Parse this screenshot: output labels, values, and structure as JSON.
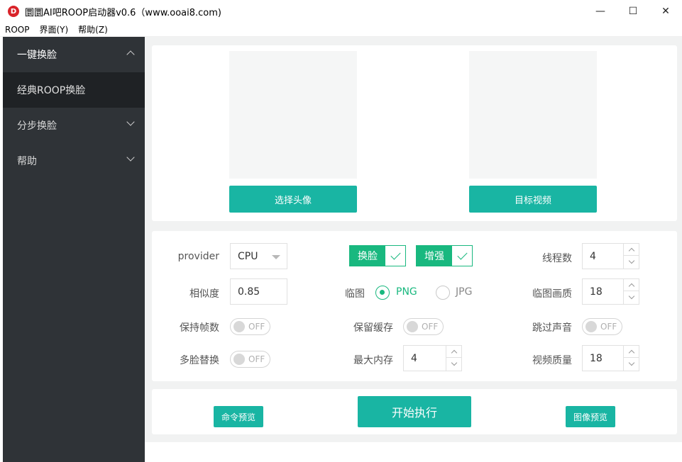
{
  "window": {
    "icon_letter": "D",
    "title": "圜圜AI吧ROOP启动器v0.6（www.ooai8.com)",
    "minimize": "—",
    "maximize": "☐",
    "close": "✕"
  },
  "menubar": [
    "ROOP",
    "界面(Y)",
    "帮助(Z)"
  ],
  "sidebar": {
    "groups": [
      {
        "label": "一键换脸",
        "expanded": true
      },
      {
        "label": "分步换脸",
        "expanded": false
      },
      {
        "label": "帮助",
        "expanded": false
      }
    ],
    "active_sub": "经典ROOP换脸"
  },
  "media": {
    "select_avatar": "选择头像",
    "target_video": "目标视频"
  },
  "settings": {
    "provider_label": "provider",
    "provider_value": "CPU",
    "similarity_label": "相似度",
    "similarity_value": "0.85",
    "keep_fps_label": "保持帧数",
    "multi_face_label": "多脸替换",
    "swap_face_tag": "换脸",
    "enhance_tag": "增强",
    "temp_frame_label": "临图",
    "format_png": "PNG",
    "format_jpg": "JPG",
    "format_selected": "PNG",
    "keep_cache_label": "保留缓存",
    "max_memory_label": "最大内存",
    "max_memory_value": "4",
    "threads_label": "线程数",
    "threads_value": "4",
    "temp_quality_label": "临图画质",
    "temp_quality_value": "18",
    "skip_audio_label": "跳过声音",
    "video_quality_label": "视频质量",
    "video_quality_value": "18",
    "off_text": "OFF"
  },
  "actions": {
    "command_preview": "命令预览",
    "start": "开始执行",
    "image_preview": "图像预览"
  },
  "colors": {
    "teal": "#19b5a3",
    "green": "#19b87f",
    "sidebar": "#2f3337",
    "sidebar_active": "#1f2225"
  }
}
